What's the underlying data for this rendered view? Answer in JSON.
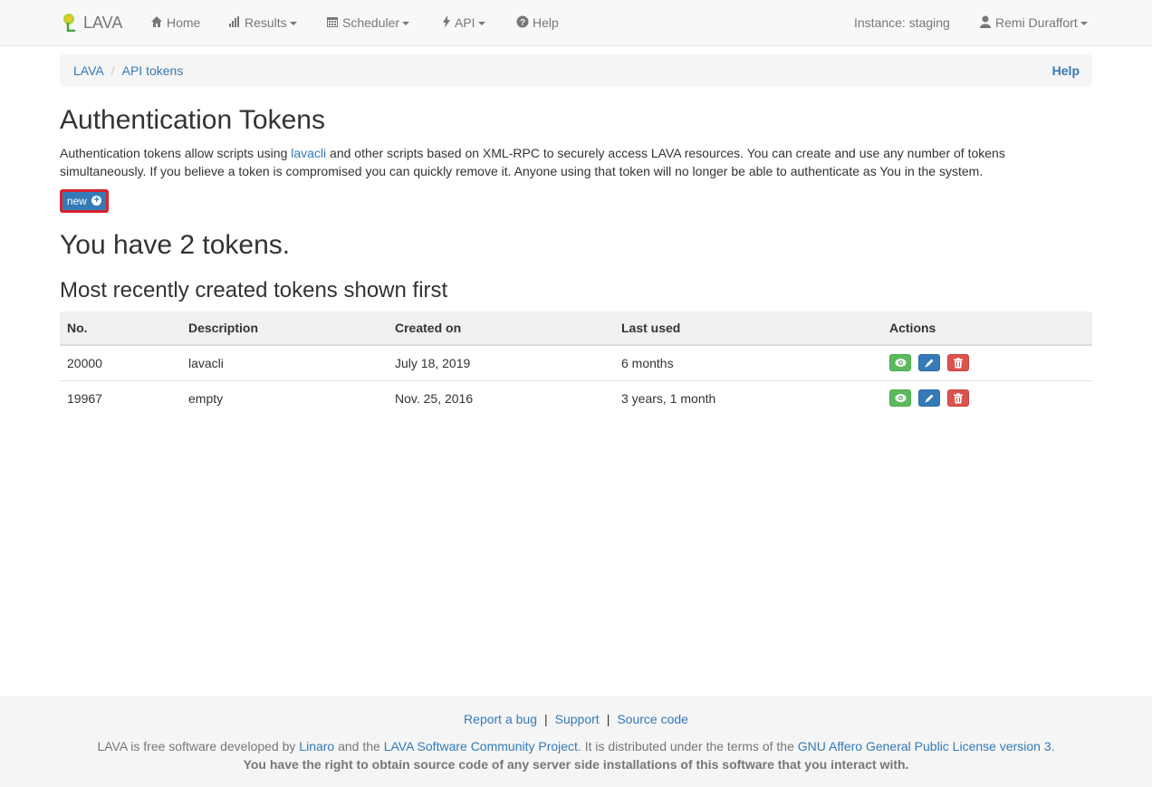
{
  "navbar": {
    "brand": "LAVA",
    "home": "Home",
    "results": "Results",
    "scheduler": "Scheduler",
    "api": "API",
    "help": "Help",
    "instance": "Instance: staging",
    "user": "Remi Duraffort"
  },
  "breadcrumb": {
    "root": "LAVA",
    "current": "API tokens",
    "help": "Help"
  },
  "page": {
    "title": "Authentication Tokens",
    "intro_before": "Authentication tokens allow scripts using ",
    "intro_link": "lavacli",
    "intro_after": " and other scripts based on XML-RPC to securely access LAVA resources. You can create and use any number of tokens simultaneously. If you believe a token is compromised you can quickly remove it. Anyone using that token will no longer be able to authenticate as You in the system.",
    "new_button": "new",
    "count_heading": "You have 2 tokens.",
    "table_heading": "Most recently created tokens shown first"
  },
  "table": {
    "headers": {
      "no": "No.",
      "description": "Description",
      "created": "Created on",
      "last_used": "Last used",
      "actions": "Actions"
    },
    "rows": [
      {
        "no": "20000",
        "description": "lavacli",
        "created": "July 18, 2019",
        "last_used": "6 months"
      },
      {
        "no": "19967",
        "description": "empty",
        "created": "Nov. 25, 2016",
        "last_used": "3 years, 1 month"
      }
    ]
  },
  "footer": {
    "report": "Report a bug",
    "support": "Support",
    "source": "Source code",
    "sep": "|",
    "license_1": "LAVA is free software developed by ",
    "linaro": "Linaro",
    "license_2": " and the ",
    "community": "LAVA Software Community Project",
    "license_3": ". It is distributed under the terms of the ",
    "gpl": "GNU Affero General Public License version 3",
    "license_4": ".",
    "rights": "You have the right to obtain source code of any server side installations of this software that you interact with."
  },
  "colors": {
    "link": "#337ab7",
    "primary_button": "#337ab7",
    "view_button": "#5cb85c",
    "delete_button": "#d9534f",
    "highlight_border": "#d9232d"
  }
}
